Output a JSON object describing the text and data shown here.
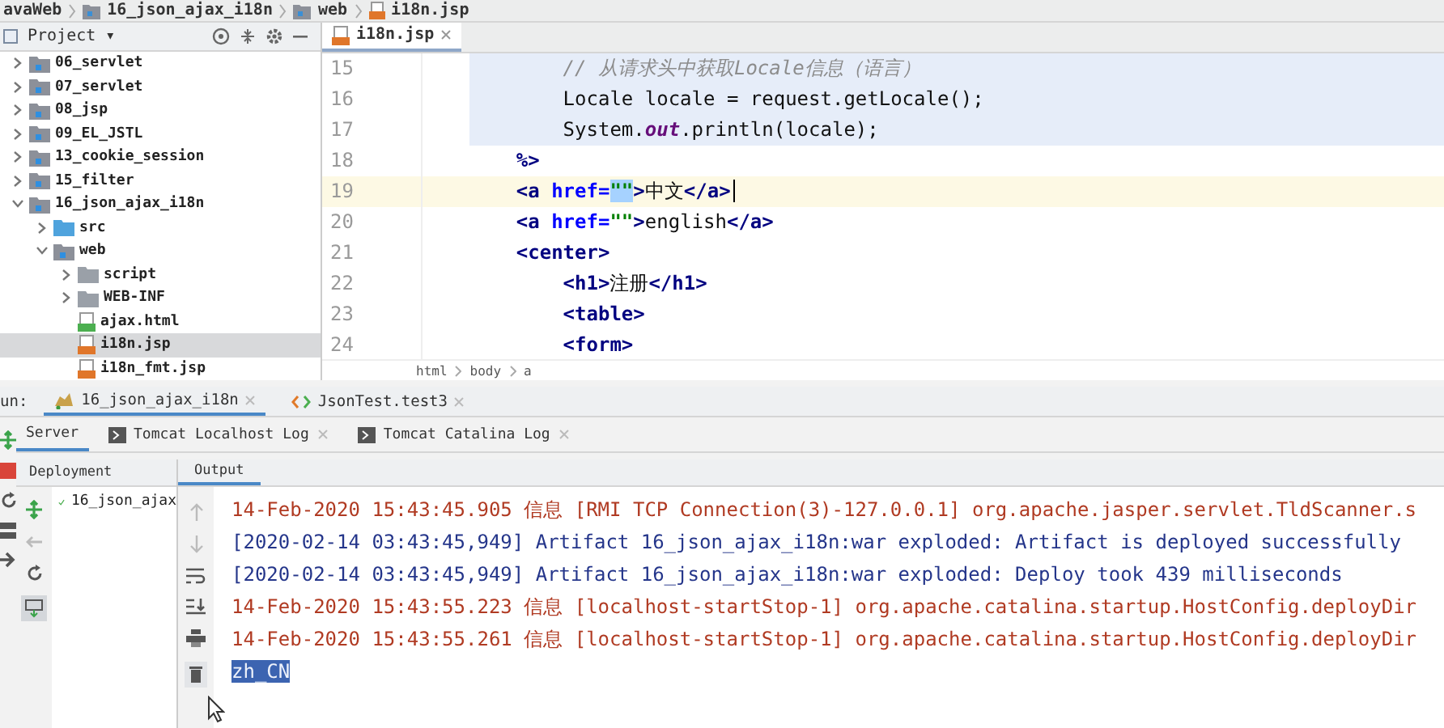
{
  "nav_bar": {
    "crumbs": [
      {
        "label": "avaWeb",
        "kind": "project"
      },
      {
        "label": "16_json_ajax_i18n",
        "kind": "module"
      },
      {
        "label": "web",
        "kind": "web"
      },
      {
        "label": "i18n.jsp",
        "kind": "jsp"
      }
    ]
  },
  "project_panel": {
    "title": "Project ▾"
  },
  "tree": {
    "items": [
      {
        "name": "06_servlet",
        "kind": "module",
        "expanded": false,
        "selected": false
      },
      {
        "name": "07_servlet",
        "kind": "module",
        "expanded": false,
        "selected": false
      },
      {
        "name": "08_jsp",
        "kind": "module",
        "expanded": false,
        "selected": false
      },
      {
        "name": "09_EL_JSTL",
        "kind": "module",
        "expanded": false,
        "selected": false
      },
      {
        "name": "13_cookie_session",
        "kind": "module",
        "expanded": false,
        "selected": false
      },
      {
        "name": "15_filter",
        "kind": "module",
        "expanded": false,
        "selected": false
      },
      {
        "name": "16_json_ajax_i18n",
        "kind": "module",
        "expanded": true,
        "selected": false,
        "children": [
          {
            "name": "src",
            "kind": "source",
            "expanded": false,
            "selected": false
          },
          {
            "name": "web",
            "kind": "web",
            "expanded": true,
            "selected": false,
            "children": [
              {
                "name": "script",
                "kind": "folder",
                "expanded": false,
                "selected": false
              },
              {
                "name": "WEB-INF",
                "kind": "folder",
                "expanded": false,
                "selected": false
              },
              {
                "name": "ajax.html",
                "kind": "html",
                "selected": false
              },
              {
                "name": "i18n.jsp",
                "kind": "jsp",
                "selected": true
              },
              {
                "name": "i18n_fmt.jsp",
                "kind": "jsp",
                "selected": false
              }
            ]
          }
        ]
      }
    ]
  },
  "editor": {
    "tabs": [
      {
        "label": "i18n.jsp",
        "selected": true
      }
    ],
    "lines": [
      {
        "number": "15",
        "scriptlet": true,
        "current": false,
        "caret": false,
        "segments": [
          {
            "kind": "comment",
            "text": "        // 从请求头中获取Locale信息（语言）"
          }
        ]
      },
      {
        "number": "16",
        "scriptlet": true,
        "current": false,
        "caret": false,
        "segments": [
          {
            "kind": "plain",
            "text": "        Locale locale = request.getLocale();"
          }
        ]
      },
      {
        "number": "17",
        "scriptlet": true,
        "current": false,
        "caret": false,
        "segments": [
          {
            "kind": "plain",
            "text": "        System."
          },
          {
            "kind": "field",
            "text": "out"
          },
          {
            "kind": "plain",
            "text": ".println(locale);"
          }
        ]
      },
      {
        "number": "18",
        "scriptlet": false,
        "current": false,
        "caret": false,
        "segments": [
          {
            "kind": "tag",
            "text": "    %>"
          }
        ]
      },
      {
        "number": "19",
        "scriptlet": false,
        "current": true,
        "caret": true,
        "segments": [
          {
            "kind": "tag",
            "text": "    <a "
          },
          {
            "kind": "attr",
            "text": "href="
          },
          {
            "kind": "selection",
            "text": "\"\""
          },
          {
            "kind": "tag",
            "text": ">"
          },
          {
            "kind": "plain",
            "text": "中文"
          },
          {
            "kind": "tag",
            "text": "</a>"
          }
        ]
      },
      {
        "number": "20",
        "scriptlet": false,
        "current": false,
        "caret": false,
        "segments": [
          {
            "kind": "tag",
            "text": "    <a "
          },
          {
            "kind": "attr",
            "text": "href="
          },
          {
            "kind": "str",
            "text": "\"\""
          },
          {
            "kind": "tag",
            "text": ">"
          },
          {
            "kind": "plain",
            "text": "english"
          },
          {
            "kind": "tag",
            "text": "</a>"
          }
        ]
      },
      {
        "number": "21",
        "scriptlet": false,
        "current": false,
        "caret": false,
        "segments": [
          {
            "kind": "tag",
            "text": "    <center>"
          }
        ]
      },
      {
        "number": "22",
        "scriptlet": false,
        "current": false,
        "caret": false,
        "segments": [
          {
            "kind": "tag",
            "text": "        <h1>"
          },
          {
            "kind": "plain",
            "text": "注册"
          },
          {
            "kind": "tag",
            "text": "</h1>"
          }
        ]
      },
      {
        "number": "23",
        "scriptlet": false,
        "current": false,
        "caret": false,
        "segments": [
          {
            "kind": "tag",
            "text": "        <table>"
          }
        ]
      },
      {
        "number": "24",
        "scriptlet": false,
        "current": false,
        "caret": false,
        "segments": [
          {
            "kind": "tag",
            "text": "        <form>"
          }
        ]
      }
    ],
    "breadcrumb": [
      "html",
      "body",
      "a"
    ]
  },
  "run_window": {
    "label": "un:",
    "tabs": [
      {
        "label": "16_json_ajax_i18n",
        "kind": "tomcat",
        "selected": true
      },
      {
        "label": "JsonTest.test3",
        "kind": "test",
        "selected": false
      }
    ],
    "server_tabs": [
      {
        "label": "Server",
        "kind": "server",
        "selected": true
      },
      {
        "label": "Tomcat Localhost Log",
        "kind": "log",
        "selected": false
      },
      {
        "label": "Tomcat Catalina Log",
        "kind": "log",
        "selected": false
      }
    ],
    "deployment": {
      "title": "Deployment",
      "items": [
        {
          "name": "16_json_ajax",
          "deployed": true
        }
      ]
    },
    "output": {
      "title": "Output",
      "lines": [
        {
          "text": "14-Feb-2020 15:43:45.905 信息 [RMI TCP Connection(3)-127.0.0.1] org.apache.jasper.servlet.TldScanner.s",
          "kind": "log",
          "selected": false
        },
        {
          "text": "[2020-02-14 03:43:45,949] Artifact 16_json_ajax_i18n:war exploded: Artifact is deployed successfully",
          "kind": "artifact",
          "selected": false
        },
        {
          "text": "[2020-02-14 03:43:45,949] Artifact 16_json_ajax_i18n:war exploded: Deploy took 439 milliseconds",
          "kind": "artifact",
          "selected": false
        },
        {
          "text": "14-Feb-2020 15:43:55.223 信息 [localhost-startStop-1] org.apache.catalina.startup.HostConfig.deployDir",
          "kind": "log",
          "selected": false
        },
        {
          "text": "14-Feb-2020 15:43:55.261 信息 [localhost-startStop-1] org.apache.catalina.startup.HostConfig.deployDir",
          "kind": "log",
          "selected": false
        },
        {
          "text": "zh_CN",
          "kind": "stdout",
          "selected": true
        }
      ]
    }
  }
}
